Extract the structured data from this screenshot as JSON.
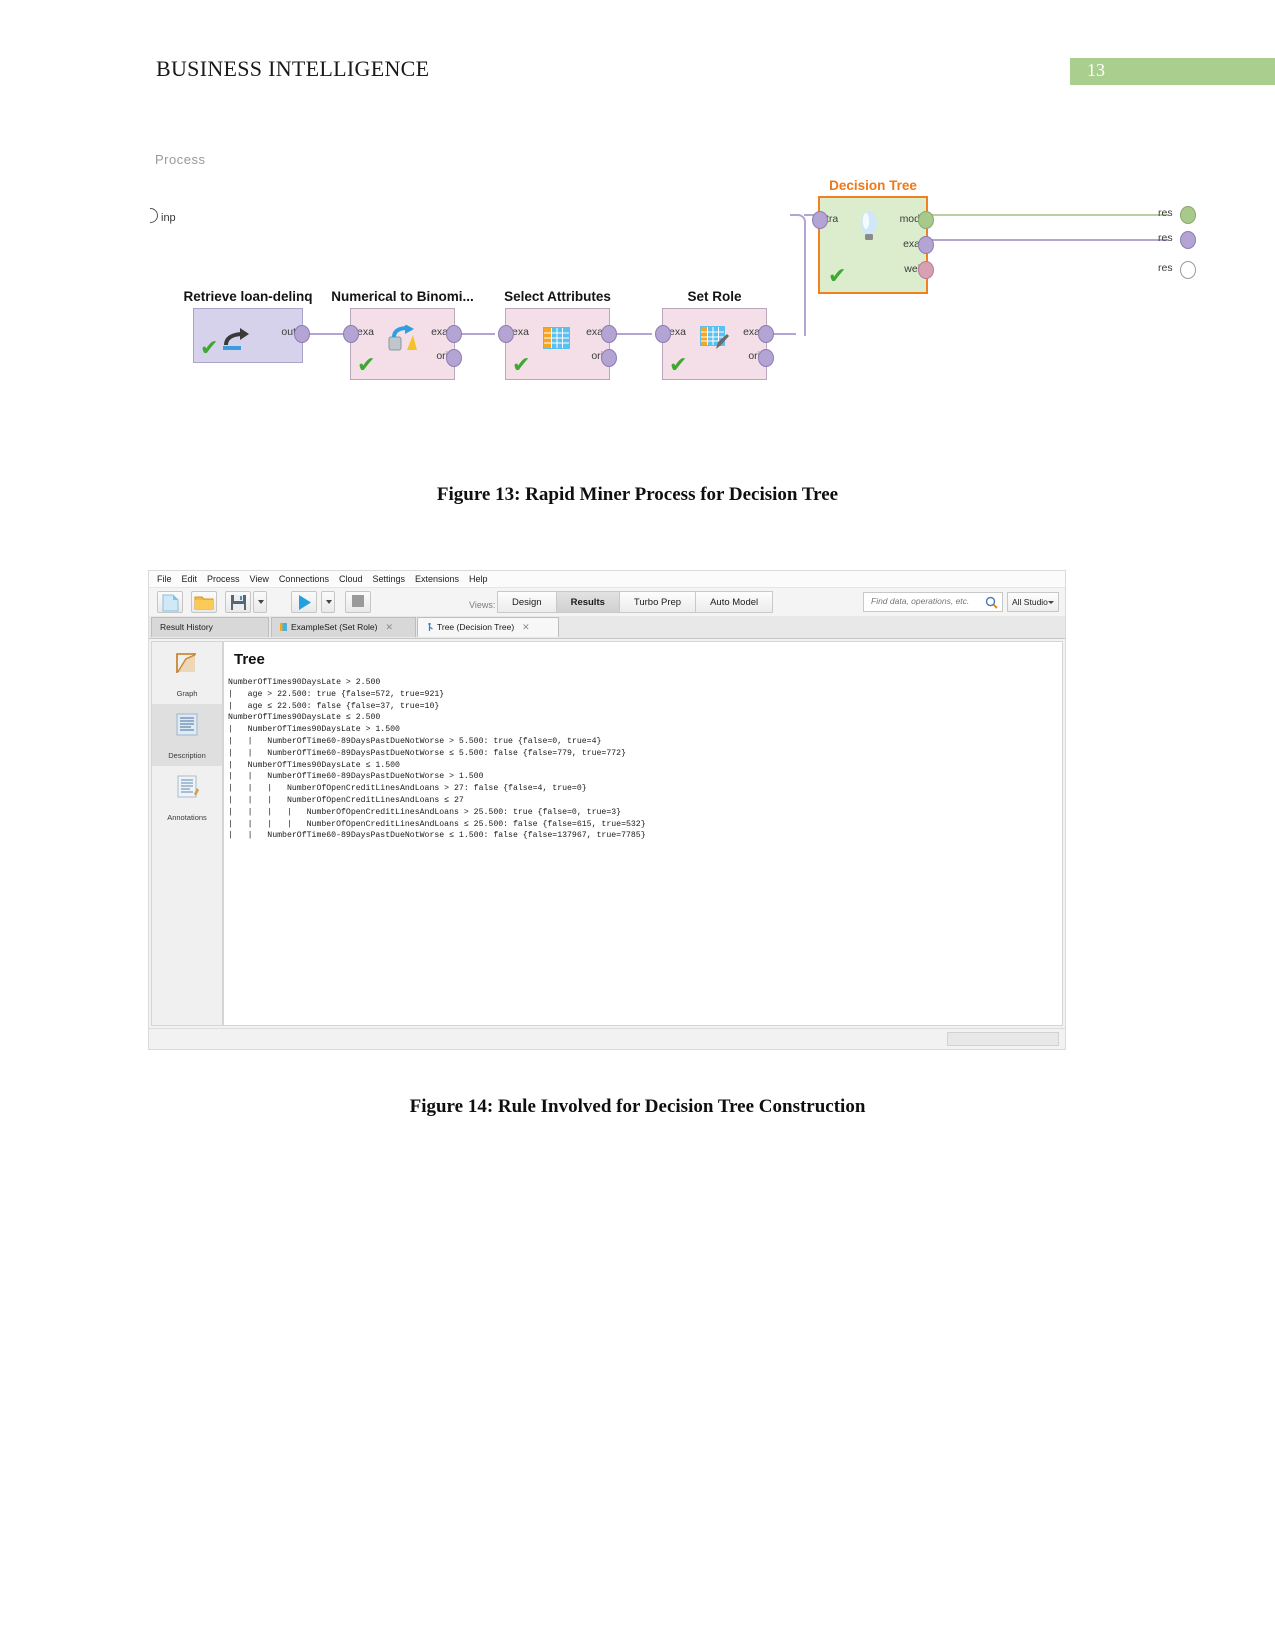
{
  "document": {
    "header_title": "BUSINESS INTELLIGENCE",
    "page_number": "13",
    "badge_color": "#a9ce8e"
  },
  "figure13": {
    "caption": "Figure 13: Rapid Miner Process for Decision Tree",
    "canvas_label": "Process",
    "input_port": "inp",
    "operators": [
      {
        "name": "Retrieve loan-delinq",
        "icon": "retrieve-arrow-icon",
        "ports_left": [],
        "ports_right": [
          "out"
        ],
        "status": "ok",
        "color": "#d6d2ec"
      },
      {
        "name": "Numerical to Binomi...",
        "icon": "numerical-to-binominal-icon",
        "ports_left": [
          "exa"
        ],
        "ports_right": [
          "exa",
          "ori"
        ],
        "status": "ok",
        "color": "#f4dfe9"
      },
      {
        "name": "Select Attributes",
        "icon": "table-columns-icon",
        "ports_left": [
          "exa"
        ],
        "ports_right": [
          "exa",
          "ori"
        ],
        "status": "ok",
        "color": "#f4dfe9"
      },
      {
        "name": "Set Role",
        "icon": "table-pencil-icon",
        "ports_left": [
          "exa"
        ],
        "ports_right": [
          "exa",
          "ori"
        ],
        "status": "ok",
        "color": "#f4dfe9"
      },
      {
        "name": "Decision Tree",
        "icon": "lightbulb-icon",
        "ports_left": [
          "tra"
        ],
        "ports_right": [
          "mod",
          "exa",
          "wei"
        ],
        "status": "ok",
        "color": "#dcedcd",
        "accent": "#f08020"
      }
    ],
    "result_ports": [
      "res",
      "res",
      "res"
    ]
  },
  "figure14": {
    "caption": "Figure 14: Rule Involved for Decision Tree Construction",
    "app": {
      "menu": [
        {
          "label": "File",
          "mnemonic": "F"
        },
        {
          "label": "Edit",
          "mnemonic": "E"
        },
        {
          "label": "Process",
          "mnemonic": "P"
        },
        {
          "label": "View",
          "mnemonic": "V"
        },
        {
          "label": "Connections",
          "mnemonic": "C"
        },
        {
          "label": "Cloud",
          "mnemonic": "d"
        },
        {
          "label": "Settings",
          "mnemonic": "S"
        },
        {
          "label": "Extensions",
          "mnemonic": "x"
        },
        {
          "label": "Help",
          "mnemonic": "H"
        }
      ],
      "toolbar": {
        "new_process": "new-process-icon",
        "open_process": "open-folder-icon",
        "save_process": "save-disk-icon",
        "save_dropdown": "chevron-down-icon",
        "run_process": "run-play-icon",
        "run_dropdown": "chevron-down-icon",
        "stop_process": "stop-square-icon"
      },
      "views_label": "Views:",
      "views": [
        {
          "label": "Design",
          "active": false
        },
        {
          "label": "Results",
          "active": true
        },
        {
          "label": "Turbo Prep",
          "active": false
        },
        {
          "label": "Auto Model",
          "active": false
        }
      ],
      "search": {
        "placeholder": "Find data, operations, etc.",
        "value": "",
        "icon": "search-icon"
      },
      "studio_selector": {
        "value": "All Studio",
        "icon": "chevron-down-icon"
      },
      "tabs": [
        {
          "label": "Result History",
          "closable": false,
          "active": false
        },
        {
          "label": "ExampleSet (Set Role)",
          "closable": true,
          "active": false,
          "icon": "table-icon"
        },
        {
          "label": "Tree (Decision Tree)",
          "closable": true,
          "active": true,
          "icon": "tree-icon"
        }
      ],
      "rail": [
        {
          "label": "Graph",
          "icon": "graph-icon",
          "active": false
        },
        {
          "label": "Description",
          "icon": "description-icon",
          "active": true
        },
        {
          "label": "Annotations",
          "icon": "annotations-icon",
          "active": false
        }
      ],
      "pane_title": "Tree",
      "tree_lines": [
        "NumberOfTimes90DaysLate > 2.500",
        "|   age > 22.500: true {false=572, true=921}",
        "|   age ≤ 22.500: false {false=37, true=10}",
        "NumberOfTimes90DaysLate ≤ 2.500",
        "|   NumberOfTimes90DaysLate > 1.500",
        "|   |   NumberOfTime60-89DaysPastDueNotWorse > 5.500: true {false=0, true=4}",
        "|   |   NumberOfTime60-89DaysPastDueNotWorse ≤ 5.500: false {false=779, true=772}",
        "|   NumberOfTimes90DaysLate ≤ 1.500",
        "|   |   NumberOfTime60-89DaysPastDueNotWorse > 1.500",
        "|   |   |   NumberOfOpenCreditLinesAndLoans > 27: false {false=4, true=0}",
        "|   |   |   NumberOfOpenCreditLinesAndLoans ≤ 27",
        "|   |   |   |   NumberOfOpenCreditLinesAndLoans > 25.500: true {false=0, true=3}",
        "|   |   |   |   NumberOfOpenCreditLinesAndLoans ≤ 25.500: false {false=615, true=532}",
        "|   |   NumberOfTime60-89DaysPastDueNotWorse ≤ 1.500: false {false=137967, true=7785}"
      ]
    }
  },
  "tree_data": {
    "type": "table",
    "root_attribute": "NumberOfTimes90DaysLate",
    "nodes": [
      {
        "depth": 0,
        "condition": "NumberOfTimes90DaysLate > 2.500",
        "leaf": false
      },
      {
        "depth": 1,
        "condition": "age > 22.500",
        "leaf": true,
        "prediction": "true",
        "counts": {
          "false": 572,
          "true": 921
        }
      },
      {
        "depth": 1,
        "condition": "age ≤ 22.500",
        "leaf": true,
        "prediction": "false",
        "counts": {
          "false": 37,
          "true": 10
        }
      },
      {
        "depth": 0,
        "condition": "NumberOfTimes90DaysLate ≤ 2.500",
        "leaf": false
      },
      {
        "depth": 1,
        "condition": "NumberOfTimes90DaysLate > 1.500",
        "leaf": false
      },
      {
        "depth": 2,
        "condition": "NumberOfTime60-89DaysPastDueNotWorse > 5.500",
        "leaf": true,
        "prediction": "true",
        "counts": {
          "false": 0,
          "true": 4
        }
      },
      {
        "depth": 2,
        "condition": "NumberOfTime60-89DaysPastDueNotWorse ≤ 5.500",
        "leaf": true,
        "prediction": "false",
        "counts": {
          "false": 779,
          "true": 772
        }
      },
      {
        "depth": 1,
        "condition": "NumberOfTimes90DaysLate ≤ 1.500",
        "leaf": false
      },
      {
        "depth": 2,
        "condition": "NumberOfTime60-89DaysPastDueNotWorse > 1.500",
        "leaf": false
      },
      {
        "depth": 3,
        "condition": "NumberOfOpenCreditLinesAndLoans > 27",
        "leaf": true,
        "prediction": "false",
        "counts": {
          "false": 4,
          "true": 0
        }
      },
      {
        "depth": 3,
        "condition": "NumberOfOpenCreditLinesAndLoans ≤ 27",
        "leaf": false
      },
      {
        "depth": 4,
        "condition": "NumberOfOpenCreditLinesAndLoans > 25.500",
        "leaf": true,
        "prediction": "true",
        "counts": {
          "false": 0,
          "true": 3
        }
      },
      {
        "depth": 4,
        "condition": "NumberOfOpenCreditLinesAndLoans ≤ 25.500",
        "leaf": true,
        "prediction": "false",
        "counts": {
          "false": 615,
          "true": 532
        }
      },
      {
        "depth": 2,
        "condition": "NumberOfTime60-89DaysPastDueNotWorse ≤ 1.500",
        "leaf": true,
        "prediction": "false",
        "counts": {
          "false": 137967,
          "true": 7785
        }
      }
    ]
  }
}
